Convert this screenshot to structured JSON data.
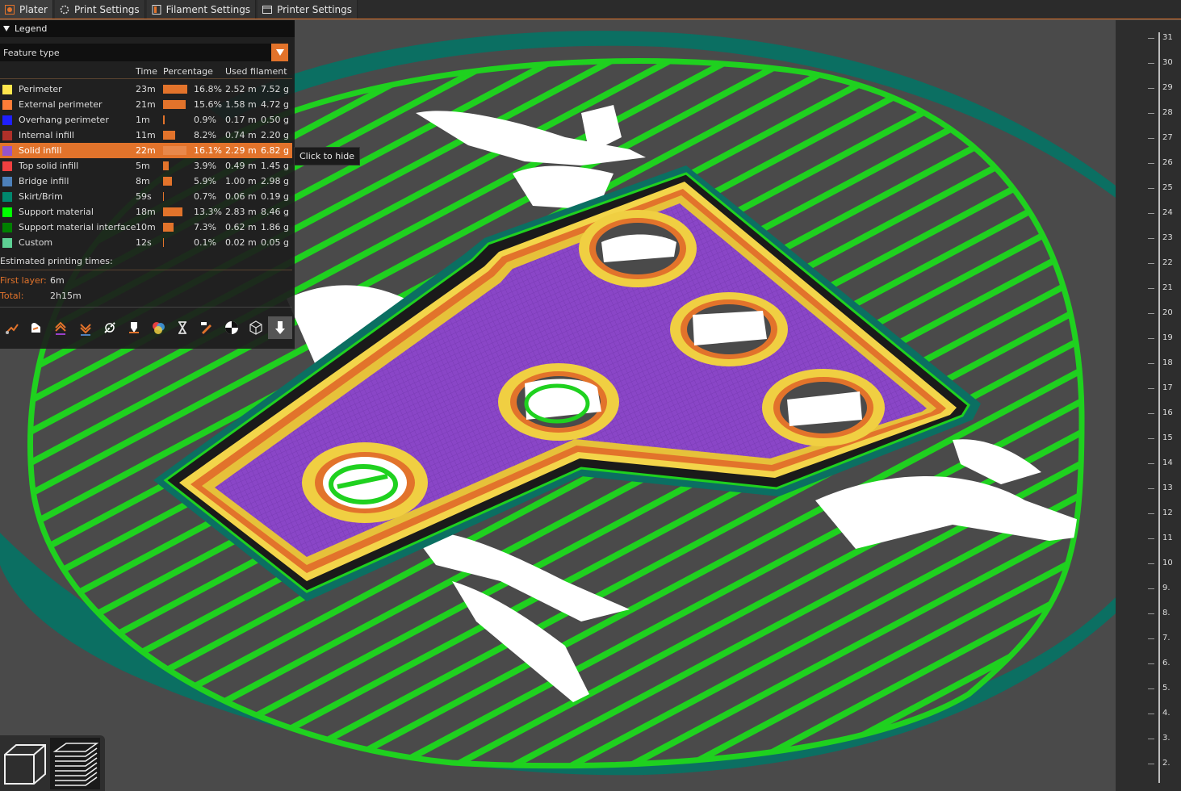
{
  "tabs": [
    {
      "label": "Plater",
      "icon": "plater-icon",
      "active": true
    },
    {
      "label": "Print Settings",
      "icon": "print-settings-icon",
      "active": false
    },
    {
      "label": "Filament Settings",
      "icon": "filament-icon",
      "active": false
    },
    {
      "label": "Printer Settings",
      "icon": "printer-icon",
      "active": false
    }
  ],
  "legend": {
    "title": "Legend",
    "view_type": "Feature type",
    "columns": {
      "time": "Time",
      "percentage": "Percentage",
      "used_filament": "Used filament"
    },
    "rows": [
      {
        "name": "Perimeter",
        "color": "#ffe64d",
        "time": "23m",
        "pct": 16.8,
        "pct_text": "16.8%",
        "length": "2.52 m",
        "weight": "7.52 g",
        "selected": false
      },
      {
        "name": "External perimeter",
        "color": "#ff7d38",
        "time": "21m",
        "pct": 15.6,
        "pct_text": "15.6%",
        "length": "1.58 m",
        "weight": "4.72 g",
        "selected": false
      },
      {
        "name": "Overhang perimeter",
        "color": "#1f1fff",
        "time": "1m",
        "pct": 0.9,
        "pct_text": "0.9%",
        "length": "0.17 m",
        "weight": "0.50 g",
        "selected": false
      },
      {
        "name": "Internal infill",
        "color": "#b03029",
        "time": "11m",
        "pct": 8.2,
        "pct_text": "8.2%",
        "length": "0.74 m",
        "weight": "2.20 g",
        "selected": false
      },
      {
        "name": "Solid infill",
        "color": "#9654cc",
        "time": "22m",
        "pct": 16.1,
        "pct_text": "16.1%",
        "length": "2.29 m",
        "weight": "6.82 g",
        "selected": true
      },
      {
        "name": "Top solid infill",
        "color": "#f04040",
        "time": "5m",
        "pct": 3.9,
        "pct_text": "3.9%",
        "length": "0.49 m",
        "weight": "1.45 g",
        "selected": false
      },
      {
        "name": "Bridge infill",
        "color": "#4d80ba",
        "time": "8m",
        "pct": 5.9,
        "pct_text": "5.9%",
        "length": "1.00 m",
        "weight": "2.98 g",
        "selected": false
      },
      {
        "name": "Skirt/Brim",
        "color": "#00876e",
        "time": "59s",
        "pct": 0.7,
        "pct_text": "0.7%",
        "length": "0.06 m",
        "weight": "0.19 g",
        "selected": false
      },
      {
        "name": "Support material",
        "color": "#00ff00",
        "time": "18m",
        "pct": 13.3,
        "pct_text": "13.3%",
        "length": "2.83 m",
        "weight": "8.46 g",
        "selected": false
      },
      {
        "name": "Support material interface",
        "color": "#008000",
        "time": "10m",
        "pct": 7.3,
        "pct_text": "7.3%",
        "length": "0.62 m",
        "weight": "1.86 g",
        "selected": false
      },
      {
        "name": "Custom",
        "color": "#5ed194",
        "time": "12s",
        "pct": 0.1,
        "pct_text": "0.1%",
        "length": "0.02 m",
        "weight": "0.05 g",
        "selected": false
      }
    ],
    "estimated_title": "Estimated printing times:",
    "first_layer_label": "First layer:",
    "first_layer_value": "6m",
    "total_label": "Total:",
    "total_value": "2h15m"
  },
  "tooltip": "Click to hide",
  "toolbar_icons": [
    "travel-icon",
    "wipe-icon",
    "retractions-icon",
    "deretractions-icon",
    "seams-icon",
    "tool-changes-icon",
    "color-changes-icon",
    "pause-icon",
    "custom-gcode-icon",
    "center-of-gravity-icon",
    "shells-icon",
    "tool-marker-icon"
  ],
  "ruler": {
    "labels": [
      "31",
      "30",
      "29",
      "28",
      "27",
      "26",
      "25",
      "24",
      "23",
      "22",
      "21",
      "20",
      "19",
      "18",
      "17",
      "16",
      "15",
      "14",
      "13",
      "12",
      "11",
      "10",
      "9.",
      "8.",
      "7.",
      "6.",
      "5.",
      "4.",
      "3.",
      "2."
    ]
  },
  "view_buttons": [
    {
      "icon": "3d-cube-icon",
      "active": false
    },
    {
      "icon": "layers-icon",
      "active": true
    }
  ],
  "colors": {
    "accent": "#e2732b",
    "support": "#1fd11f",
    "brim": "#0b6f62",
    "solid_infill": "#8a46c7"
  }
}
